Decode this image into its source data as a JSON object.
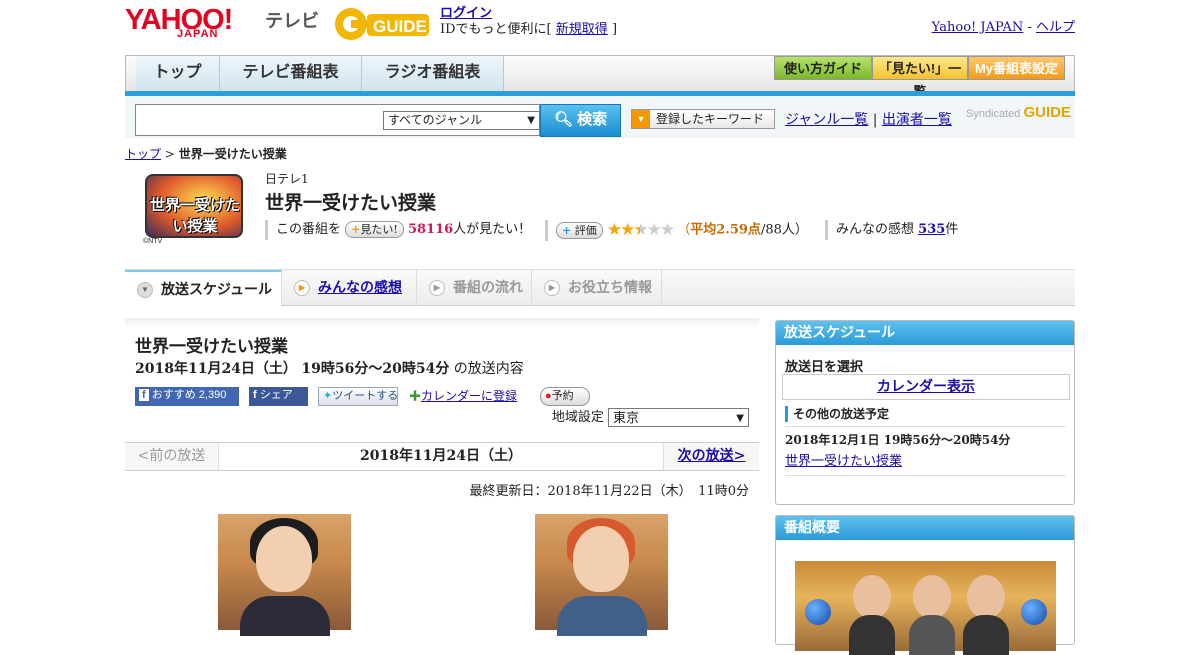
{
  "header": {
    "logo_yahoo": "YAHOO!",
    "logo_japan": "JAPAN",
    "logo_tv": "テレビ",
    "logo_gguide": "GUIDE",
    "login": "ログイン",
    "login_sub": "IDでもっと便利に[",
    "signup": "新規取得",
    "login_close": "]",
    "yahoo_japan": "Yahoo! JAPAN",
    "sep": "-",
    "help": "ヘルプ"
  },
  "nav": {
    "tabs": [
      "トップ",
      "テレビ番組表",
      "ラジオ番組表"
    ],
    "buttons": [
      "使い方ガイド",
      "「見たい!」一覧",
      "My番組表設定"
    ]
  },
  "search": {
    "input_value": "",
    "genre": "すべてのジャンル",
    "button": "検索",
    "keyword_button": "登録したキーワード",
    "genre_list": "ジャンル一覧",
    "divider": "|",
    "performer_list": "出演者一覧",
    "syndicated": "Syndicated",
    "syndicated_brand": "GUIDE"
  },
  "breadcrumb": {
    "home": "トップ",
    "sep": ">",
    "current": "世界一受けたい授業"
  },
  "program": {
    "logo_text": "世界一受けたい授業",
    "copyright": "©NTV",
    "channel": "日テレ1",
    "title": "世界一受けたい授業",
    "this_program": "この番組を",
    "want_button": "見たい!",
    "want_count": "58116",
    "want_suffix": "人が見たい！",
    "rate_button": "評価",
    "rating": 2.59,
    "avg_open": "（",
    "avg_text": "平均2.59点",
    "avg_count": "/88人）",
    "reviews_label": "みんなの感想",
    "reviews_count": "535",
    "reviews_suffix": "件"
  },
  "tabs": [
    "放送スケジュール",
    "みんなの感想",
    "番組の流れ",
    "お役立ち情報"
  ],
  "main": {
    "title": "世界一受けたい授業",
    "date": "2018年11月24日（土）",
    "time": "19時56分～20時54分",
    "date_suffix": "の放送内容",
    "fb_recommend": "おすすめ",
    "fb_count": "2,390",
    "fb_share": "シェア",
    "tweet": "ツイートする",
    "calendar": "カレンダーに登録",
    "reserve": "予約",
    "region_label": "地域設定",
    "region": "東京",
    "prev": "<前の放送",
    "current_date": "2018年11月24日（土）",
    "next": "次の放送>",
    "updated": "最終更新日：2018年11月22日（木）　11時0分"
  },
  "sidebar": {
    "schedule_title": "放送スケジュール",
    "select_date": "放送日を選択",
    "calendar_link": "カレンダー表示",
    "other_title": "その他の放送予定",
    "other_date": "2018年12月1日 19時56分～20時54分",
    "other_link": "世界一受けたい授業",
    "overview_title": "番組概要"
  },
  "colors": {
    "accent_blue": "#2a9ad8",
    "yahoo_red": "#e6001f",
    "star": "#f0a800",
    "want_count": "#d4145a"
  }
}
